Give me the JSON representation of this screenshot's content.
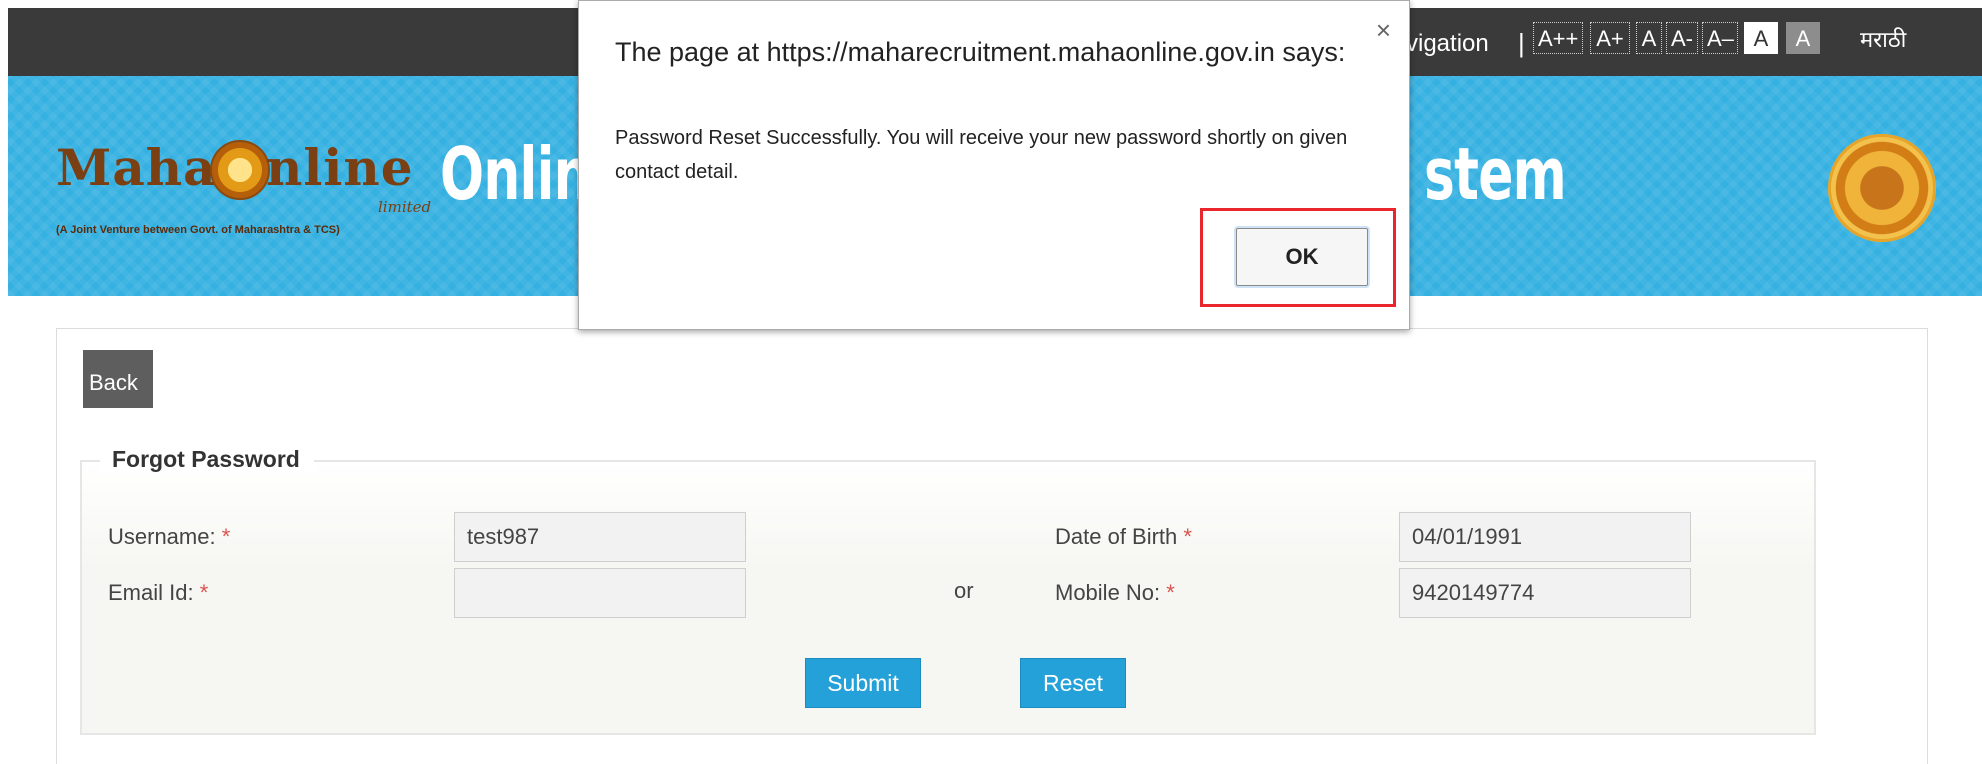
{
  "topbar": {
    "nav_text": "vigation",
    "separator": "|",
    "font_controls": [
      "A++",
      "A+",
      "A",
      "A-",
      "A–"
    ],
    "contrast_controls": [
      "A",
      "A"
    ],
    "language_link": "मराठी"
  },
  "header": {
    "logo_left_word": "Maha",
    "logo_right_word": "nline",
    "logo_subtext": "limited",
    "logo_tagline": "(A Joint Venture between Govt. of Maharashtra & TCS)",
    "title_left": "Onlin",
    "title_right": "stem"
  },
  "page": {
    "back_button": "Back"
  },
  "form": {
    "legend": "Forgot Password",
    "username_label": "Username:",
    "email_label": "Email Id:",
    "dob_label": "Date of Birth",
    "mobile_label": "Mobile No:",
    "required_mark": "*",
    "or_text": "or",
    "username_value": "test987",
    "email_value": "",
    "dob_value": "04/01/1991",
    "mobile_value": "9420149774",
    "submit_label": "Submit",
    "reset_label": "Reset"
  },
  "dialog": {
    "title": "The page at https://maharecruitment.mahaonline.gov.in says:",
    "close_icon": "×",
    "message": "Password Reset Successfully. You will receive your new password shortly on given contact detail.",
    "ok_label": "OK"
  },
  "colors": {
    "header_blue": "#34b0e1",
    "topbar": "#3a3a3a",
    "button_blue": "#24a1d8",
    "highlight_red": "#e8262c"
  }
}
